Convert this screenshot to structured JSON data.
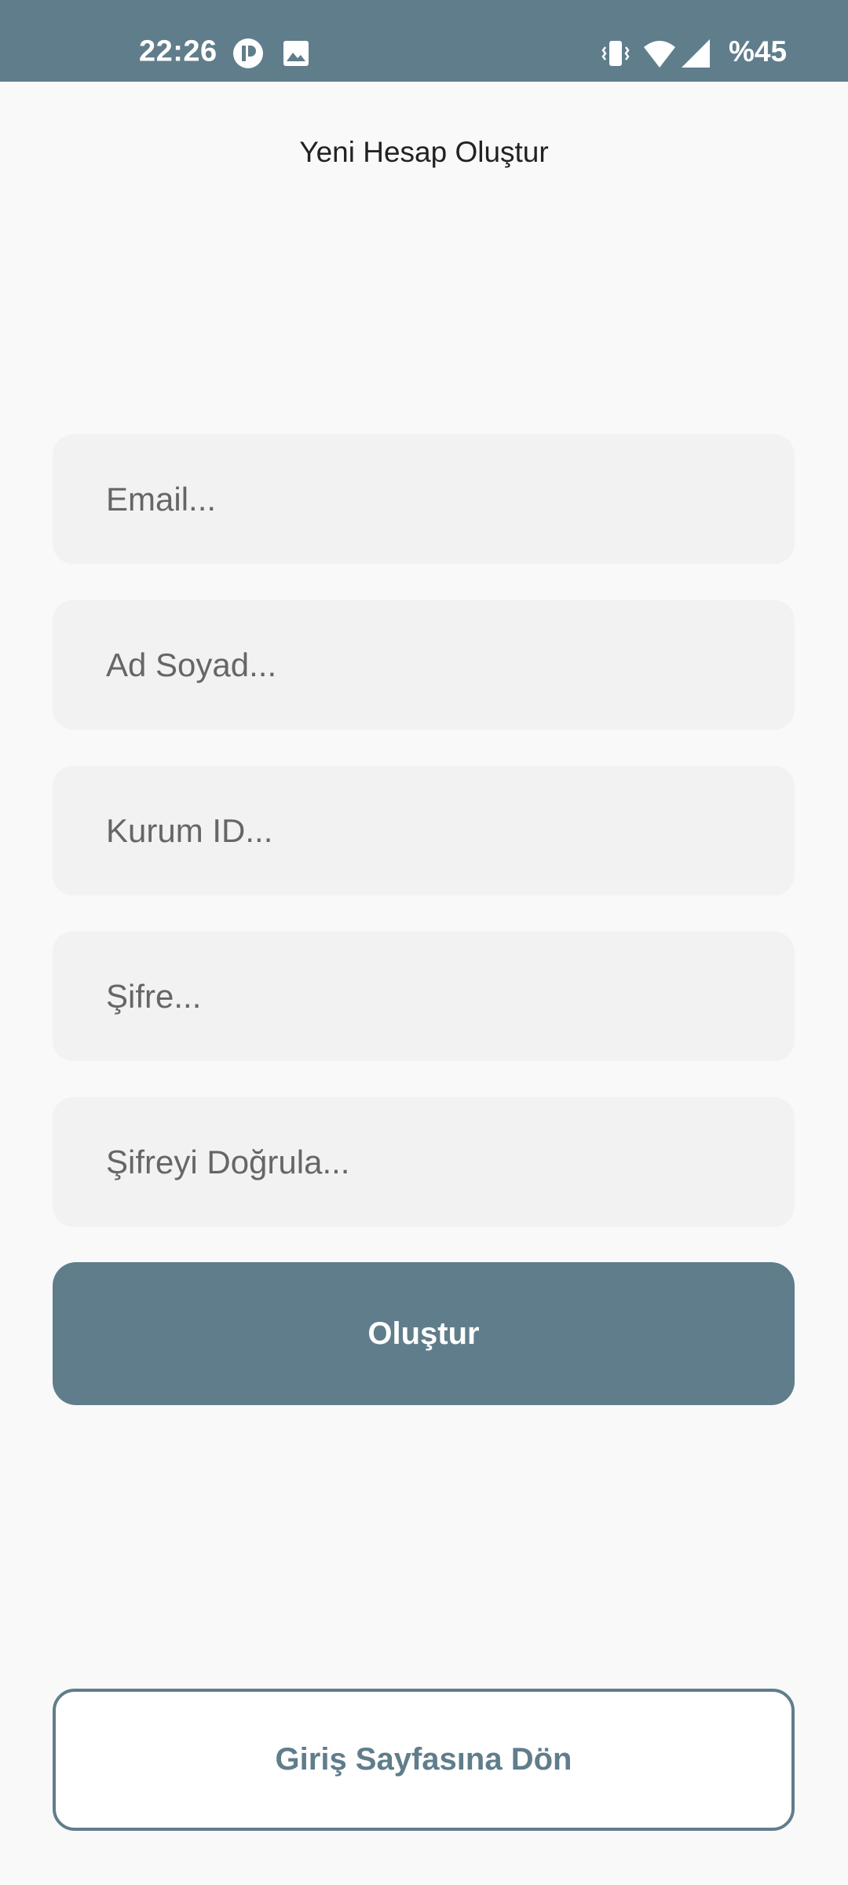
{
  "status_bar": {
    "time": "22:26",
    "battery": "%45",
    "background_color": "#607d8b",
    "icons": [
      "app-notification-icon",
      "image-icon",
      "vibrate-icon",
      "wifi-icon",
      "cell-signal-icon"
    ]
  },
  "page": {
    "title": "Yeni Hesap Oluştur"
  },
  "form": {
    "email_placeholder": "Email...",
    "name_placeholder": "Ad Soyad...",
    "org_id_placeholder": "Kurum ID...",
    "password_placeholder": "Şifre...",
    "confirm_password_placeholder": "Şifreyi Doğrula...",
    "submit_label": "Oluştur"
  },
  "footer": {
    "back_to_login_label": "Giriş Sayfasına Dön"
  },
  "colors": {
    "accent": "#607d8b",
    "background": "#f9f9f9",
    "field_background": "#f2f2f2"
  }
}
